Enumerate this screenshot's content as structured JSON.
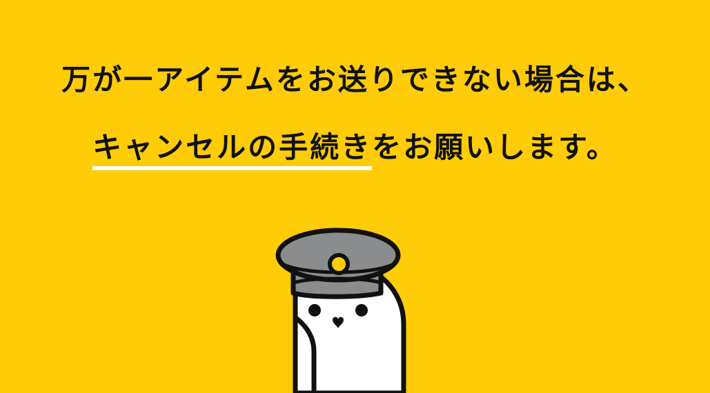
{
  "headline": {
    "line1": "万が一アイテムをお送りできない場合は、",
    "line2_highlight": "キャンセルの手続き",
    "line2_rest": "をお願いします。"
  },
  "colors": {
    "background": "#FFCC07",
    "text": "#111111",
    "underline": "#FFFFFF",
    "cap": "#8A8C8E",
    "badge": "#FFCC07"
  },
  "illustration": {
    "subject": "conductor-mascot",
    "icons": [
      "conductor-cap-icon",
      "cap-badge-icon",
      "eye-icon",
      "heart-nose-icon"
    ]
  }
}
